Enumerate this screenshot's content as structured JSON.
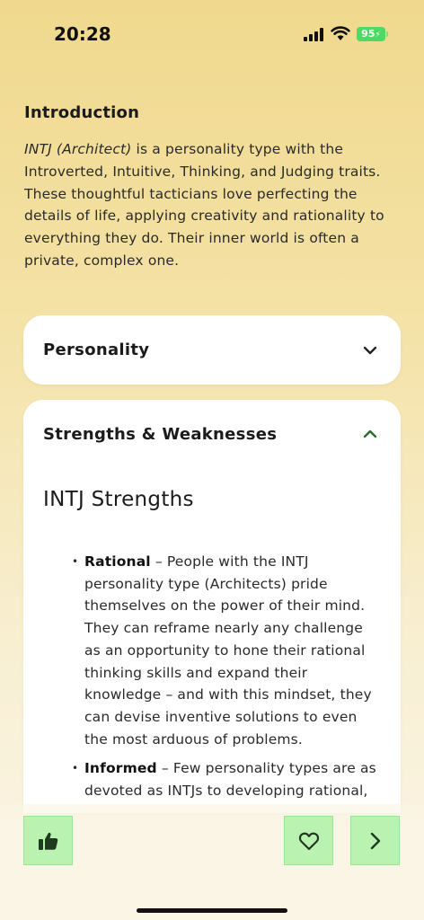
{
  "status": {
    "time": "20:28",
    "battery": "95",
    "icons": [
      "cellular-signal-icon",
      "wifi-icon",
      "battery-icon"
    ]
  },
  "intro": {
    "heading": "Introduction",
    "type_name": "INTJ (Architect)",
    "body": " is a personality type with the Introverted, Intuitive, Thinking, and Judging traits. These thoughtful tacticians love perfecting the details of life, applying creativity and rationality to everything they do. Their inner world is often a private, complex one."
  },
  "sections": [
    {
      "title": "Personality",
      "expanded": false,
      "icon": "chevron-down-icon"
    },
    {
      "title": "Strengths & Weaknesses",
      "expanded": true,
      "icon": "chevron-up-icon"
    }
  ],
  "strengths": {
    "heading": "INTJ Strengths",
    "items": [
      {
        "term": "Rational",
        "text": " – People with the INTJ personality type (Architects) pride themselves on the power of their mind. They can reframe nearly any challenge as an opportunity to hone their rational thinking skills and expand their knowledge – and with this mindset, they can devise inventive solutions to even the most arduous of problems."
      },
      {
        "term": "Informed",
        "text": " – Few personality types are as devoted as INTJs to developing rational,"
      }
    ]
  },
  "bottom_actions": [
    {
      "name": "like",
      "icon": "thumbs-up-icon"
    },
    {
      "name": "favorite",
      "icon": "heart-icon"
    },
    {
      "name": "next",
      "icon": "chevron-right-icon"
    }
  ],
  "colors": {
    "accent_green": "#b9f2b1",
    "chevron_up": "#2e6b2e",
    "battery": "#4cd964"
  }
}
